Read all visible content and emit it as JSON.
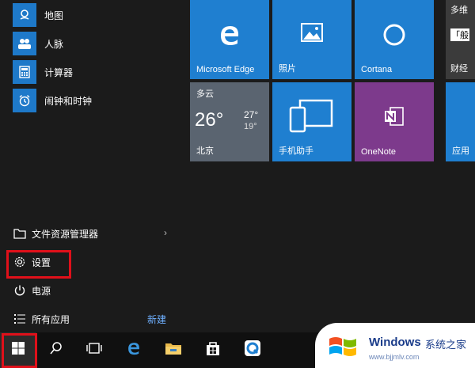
{
  "apps": [
    {
      "label": "地图",
      "icon": "map-icon"
    },
    {
      "label": "人脉",
      "icon": "people-icon"
    },
    {
      "label": "计算器",
      "icon": "calculator-icon"
    },
    {
      "label": "闹钟和时钟",
      "icon": "alarm-clock-icon"
    }
  ],
  "system": {
    "file_explorer": "文件资源管理器",
    "settings": "设置",
    "power": "电源",
    "all_apps": "所有应用",
    "new": "新建"
  },
  "tiles": {
    "edge": "Microsoft Edge",
    "photos": "照片",
    "cortana": "Cortana",
    "news_top": "多维",
    "news_bottom": "财经",
    "news_snippet": "「般",
    "weather_cond": "多云",
    "weather_temp": "26°",
    "weather_high": "27°",
    "weather_low": "19°",
    "weather_city": "北京",
    "phone": "手机助手",
    "onenote": "OneNote",
    "store": "应用"
  },
  "watermark": {
    "brand": "Windows",
    "brand_cn": "系统之家",
    "url": "www.bjjmlv.com"
  },
  "colors": {
    "tile_blue": "#1f7fd0",
    "tile_purple": "#7d3a8c",
    "highlight_red": "#e0101a"
  }
}
